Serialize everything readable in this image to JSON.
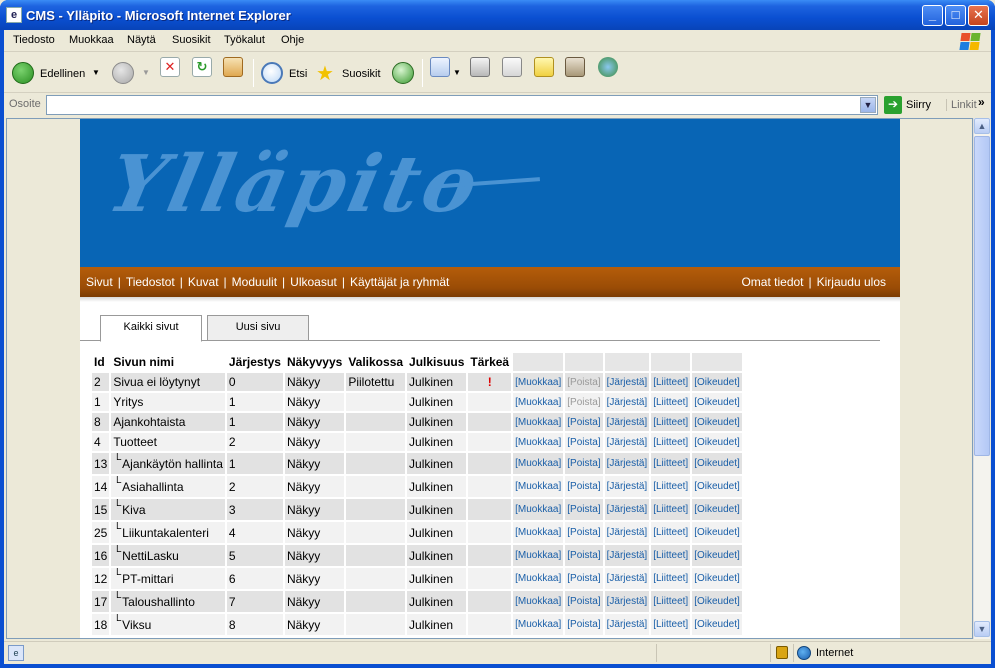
{
  "window": {
    "title": "CMS - Ylläpito - Microsoft Internet Explorer",
    "minimize": "_",
    "maximize": "□",
    "close": "✕"
  },
  "menu": [
    "Tiedosto",
    "Muokkaa",
    "Näytä",
    "Suosikit",
    "Työkalut",
    "Ohje"
  ],
  "toolbar": {
    "back_label": "Edellinen",
    "search_label": "Etsi",
    "favorites_label": "Suosikit"
  },
  "address": {
    "label": "Osoite",
    "value": "",
    "go_label": "Siirry",
    "links_label": "Linkit",
    "links_chevron": "»"
  },
  "site": {
    "banner_title": "Ylläpito",
    "nav_left": [
      "Sivut",
      "Tiedostot",
      "Kuvat",
      "Moduulit",
      "Ulkoasut",
      "Käyttäjät ja ryhmät"
    ],
    "nav_right": [
      "Omat tiedot",
      "Kirjaudu ulos"
    ],
    "tabs": [
      "Kaikki sivut",
      "Uusi sivu"
    ]
  },
  "table": {
    "headers": [
      "Id",
      "Sivun nimi",
      "Järjestys",
      "Näkyvyys",
      "Valikossa",
      "Julkisuus",
      "Tärkeä"
    ],
    "child_marker": "└",
    "actions": [
      "[Muokkaa]",
      "[Poista]",
      "[Järjestä]",
      "[Liitteet]",
      "[Oikeudet]"
    ],
    "rows": [
      {
        "id": "2",
        "name": "Sivua ei löytynyt",
        "child": false,
        "order": "0",
        "visibility": "Näkyy",
        "menu": "Piilotettu",
        "publicity": "Julkinen",
        "important": "!",
        "delete_disabled": true
      },
      {
        "id": "1",
        "name": "Yritys",
        "child": false,
        "order": "1",
        "visibility": "Näkyy",
        "menu": "",
        "publicity": "Julkinen",
        "important": "",
        "delete_disabled": true
      },
      {
        "id": "8",
        "name": "Ajankohtaista",
        "child": false,
        "order": "1",
        "visibility": "Näkyy",
        "menu": "",
        "publicity": "Julkinen",
        "important": "",
        "delete_disabled": false
      },
      {
        "id": "4",
        "name": "Tuotteet",
        "child": false,
        "order": "2",
        "visibility": "Näkyy",
        "menu": "",
        "publicity": "Julkinen",
        "important": "",
        "delete_disabled": false
      },
      {
        "id": "13",
        "name": "Ajankäytön hallinta",
        "child": true,
        "order": "1",
        "visibility": "Näkyy",
        "menu": "",
        "publicity": "Julkinen",
        "important": "",
        "delete_disabled": false
      },
      {
        "id": "14",
        "name": "Asiahallinta",
        "child": true,
        "order": "2",
        "visibility": "Näkyy",
        "menu": "",
        "publicity": "Julkinen",
        "important": "",
        "delete_disabled": false
      },
      {
        "id": "15",
        "name": "Kiva",
        "child": true,
        "order": "3",
        "visibility": "Näkyy",
        "menu": "",
        "publicity": "Julkinen",
        "important": "",
        "delete_disabled": false
      },
      {
        "id": "25",
        "name": "Liikuntakalenteri",
        "child": true,
        "order": "4",
        "visibility": "Näkyy",
        "menu": "",
        "publicity": "Julkinen",
        "important": "",
        "delete_disabled": false
      },
      {
        "id": "16",
        "name": "NettiLasku",
        "child": true,
        "order": "5",
        "visibility": "Näkyy",
        "menu": "",
        "publicity": "Julkinen",
        "important": "",
        "delete_disabled": false
      },
      {
        "id": "12",
        "name": "PT-mittari",
        "child": true,
        "order": "6",
        "visibility": "Näkyy",
        "menu": "",
        "publicity": "Julkinen",
        "important": "",
        "delete_disabled": false
      },
      {
        "id": "17",
        "name": "Taloushallinto",
        "child": true,
        "order": "7",
        "visibility": "Näkyy",
        "menu": "",
        "publicity": "Julkinen",
        "important": "",
        "delete_disabled": false
      },
      {
        "id": "18",
        "name": "Viksu",
        "child": true,
        "order": "8",
        "visibility": "Näkyy",
        "menu": "",
        "publicity": "Julkinen",
        "important": "",
        "delete_disabled": false
      }
    ]
  },
  "status": {
    "text": "",
    "zone": "Internet"
  },
  "colors": {
    "banner": "#0865b5",
    "nav": "#9a4c06",
    "link": "#1a5fa8"
  }
}
